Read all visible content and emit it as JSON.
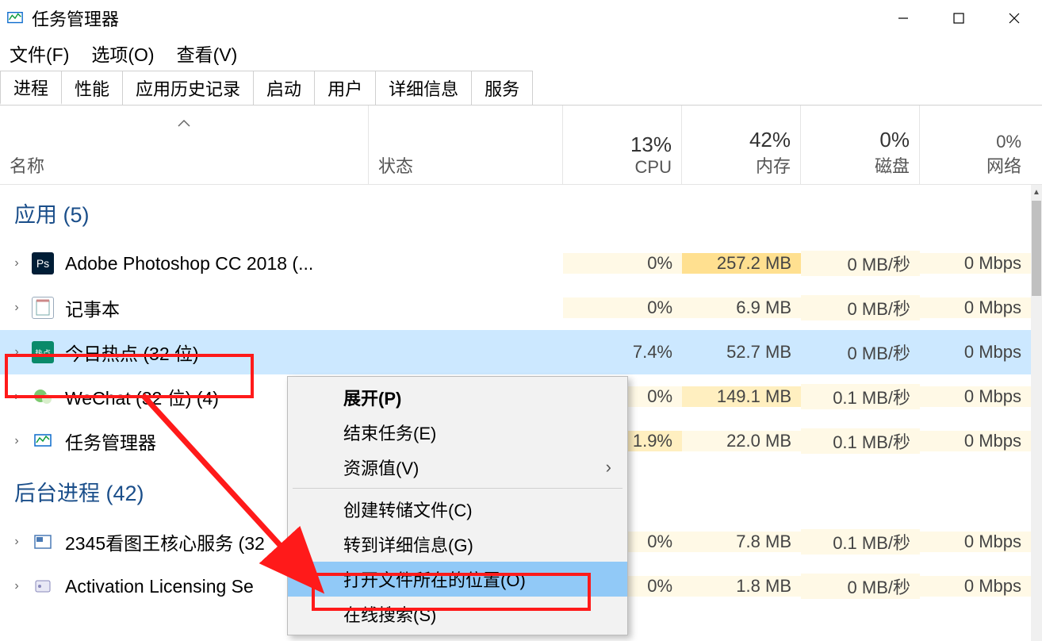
{
  "window": {
    "title": "任务管理器"
  },
  "menu": {
    "file": "文件(F)",
    "options": "选项(O)",
    "view": "查看(V)"
  },
  "tabs": {
    "processes": "进程",
    "performance": "性能",
    "app_history": "应用历史记录",
    "startup": "启动",
    "users": "用户",
    "details": "详细信息",
    "services": "服务"
  },
  "columns": {
    "name": "名称",
    "status": "状态",
    "cpu_pct": "13%",
    "cpu_label": "CPU",
    "mem_pct": "42%",
    "mem_label": "内存",
    "disk_pct": "0%",
    "disk_label": "磁盘",
    "net_pct": "0%",
    "net_label": "网络"
  },
  "groups": {
    "apps": "应用 (5)",
    "bg": "后台进程 (42)"
  },
  "apps": [
    {
      "name": "Adobe Photoshop CC 2018 (...",
      "cpu": "0%",
      "mem": "257.2 MB",
      "disk": "0 MB/秒",
      "net": "0 Mbps"
    },
    {
      "name": "记事本",
      "cpu": "0%",
      "mem": "6.9 MB",
      "disk": "0 MB/秒",
      "net": "0 Mbps"
    },
    {
      "name": "今日热点 (32 位)",
      "cpu": "7.4%",
      "mem": "52.7 MB",
      "disk": "0 MB/秒",
      "net": "0 Mbps"
    },
    {
      "name": "WeChat (32 位) (4)",
      "cpu": "0%",
      "mem": "149.1 MB",
      "disk": "0.1 MB/秒",
      "net": "0 Mbps"
    },
    {
      "name": "任务管理器",
      "cpu": "1.9%",
      "mem": "22.0 MB",
      "disk": "0.1 MB/秒",
      "net": "0 Mbps"
    }
  ],
  "bg_procs": [
    {
      "name": "2345看图王核心服务 (32 ",
      "cpu": "0%",
      "mem": "7.8 MB",
      "disk": "0.1 MB/秒",
      "net": "0 Mbps"
    },
    {
      "name": "Activation Licensing Se",
      "cpu": "0%",
      "mem": "1.8 MB",
      "disk": "0 MB/秒",
      "net": "0 Mbps"
    }
  ],
  "icon_labels": {
    "ps": "Ps",
    "hot": "热点"
  },
  "context_menu": {
    "expand": "展开(P)",
    "end_task": "结束任务(E)",
    "resource_values": "资源值(V)",
    "create_dump": "创建转储文件(C)",
    "go_to_details": "转到详细信息(G)",
    "open_file_location": "打开文件所在的位置(O)",
    "search_online": "在线搜索(S)"
  }
}
